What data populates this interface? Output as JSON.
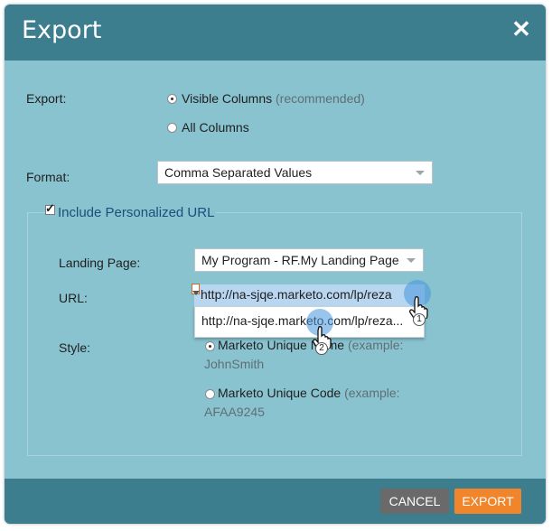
{
  "dialog": {
    "title": "Export",
    "close_icon": "close-icon"
  },
  "export": {
    "label": "Export:",
    "options": [
      {
        "label": "Visible Columns",
        "hint": "(recommended)",
        "selected": true
      },
      {
        "label": "All Columns",
        "hint": "",
        "selected": false
      }
    ]
  },
  "format": {
    "label": "Format:",
    "value": "Comma Separated Values"
  },
  "personalized_url": {
    "checkbox_label": "Include Personalized URL",
    "checked": true,
    "landing_page": {
      "label": "Landing Page:",
      "value": "My Program - RF.My Landing Page"
    },
    "url": {
      "label": "URL:",
      "value": "http://na-sjqe.marketo.com/lp/reza",
      "dropdown_option": "http://na-sjqe.marketo.com/lp/reza..."
    },
    "style": {
      "label": "Style:",
      "options": [
        {
          "label": "Marketo Unique Name",
          "hint": "(example:",
          "example": "JohnSmith",
          "selected": true
        },
        {
          "label": "Marketo Unique Code",
          "hint": "(example:",
          "example": "AFAA9245",
          "selected": false
        }
      ]
    }
  },
  "annotations": {
    "step1": "1",
    "step2": "2"
  },
  "footer": {
    "cancel_label": "CANCEL",
    "export_label": "EXPORT"
  },
  "colors": {
    "title_bar": "#3c7d8e",
    "body": "#89c3d0",
    "export_button": "#f0852c",
    "cancel_button": "#6a6a6a"
  }
}
